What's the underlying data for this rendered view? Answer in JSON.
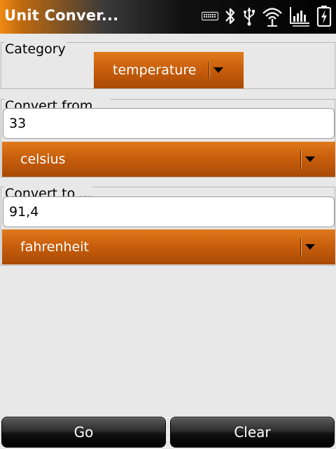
{
  "app": {
    "title": "Unit Conver..."
  },
  "status_bar": {
    "icons": [
      "keyboard-icon",
      "bluetooth-icon",
      "usb-icon",
      "wifi-icon",
      "signal-icon",
      "battery-charging-icon"
    ]
  },
  "category": {
    "label": "Category",
    "selected": "temperature"
  },
  "convert_from": {
    "label": "Convert from ...",
    "value": "33",
    "unit": "celsius"
  },
  "convert_to": {
    "label": "Convert to ...",
    "value": "91,4",
    "unit": "fahrenheit"
  },
  "buttons": {
    "go": "Go",
    "clear": "Clear"
  },
  "colors": {
    "accent_orange": "#c95f0c",
    "title_bar": "#000000",
    "background": "#e8e8e8"
  }
}
